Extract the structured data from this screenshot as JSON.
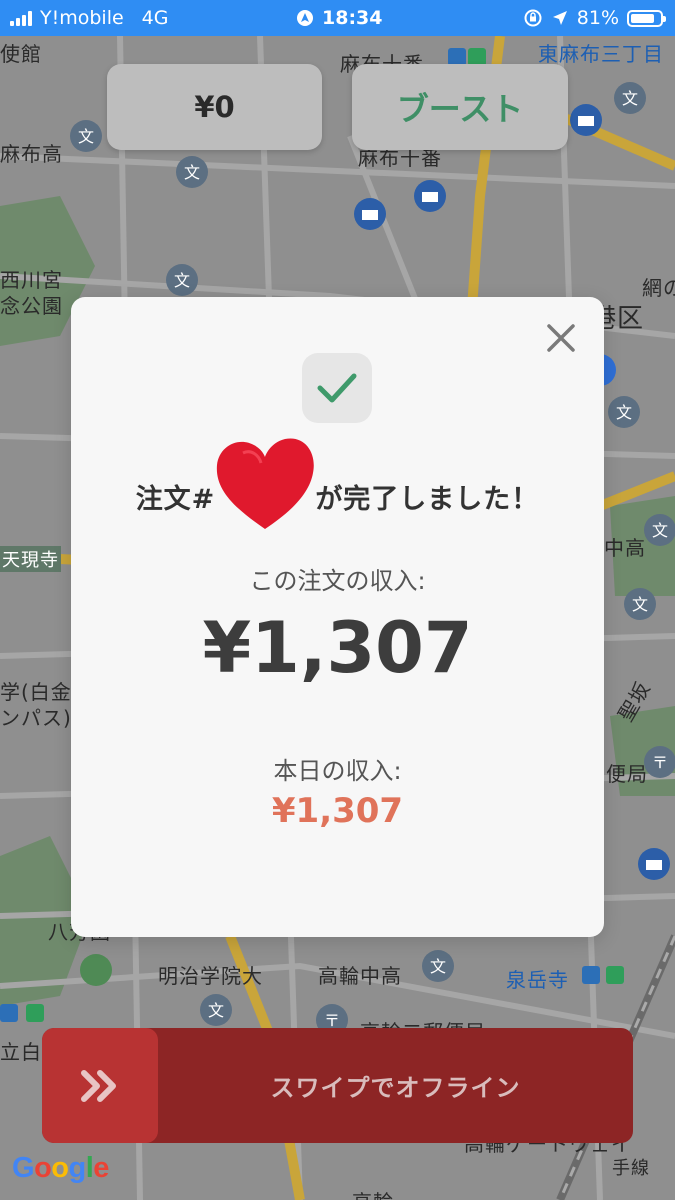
{
  "status_bar": {
    "carrier": "Y!mobile",
    "network": "4G",
    "time": "18:34",
    "battery_text": "81%",
    "battery_level": 0.81
  },
  "map": {
    "labels": [
      "使館",
      "麻布十番",
      "東麻布三丁目",
      "麻布高",
      "麻布十番",
      "西川宮",
      "念公園",
      "網の",
      "港区",
      "天現寺",
      "中高",
      "学(白金",
      "ンパス)",
      "聖坂",
      "便局",
      "八芳園",
      "明治学院大",
      "高輪中高",
      "泉岳寺",
      "立白",
      "高輪二郵便局",
      "高輪ゲートウェイ",
      "手線",
      "高輪"
    ],
    "colors": {
      "road_major": "#f2c230",
      "subway_accent": "#2f9e5a"
    }
  },
  "top_bar": {
    "earnings": "¥0",
    "boost": "ブースト"
  },
  "modal": {
    "title_prefix": "注文#",
    "title_suffix": "が完了しました！",
    "order_income_label": "この注文の収入:",
    "order_income": "¥1,307",
    "today_income_label": "本日の収入:",
    "today_income": "¥1,307",
    "colors": {
      "check": "#3f9a6b",
      "today_amount": "#e0735a"
    }
  },
  "swipe": {
    "label": "スワイプでオフライン",
    "colors": {
      "bar": "#8d2525",
      "knob": "#b83333"
    }
  },
  "attribution": {
    "letters": [
      "G",
      "o",
      "o",
      "g",
      "l",
      "e"
    ]
  }
}
